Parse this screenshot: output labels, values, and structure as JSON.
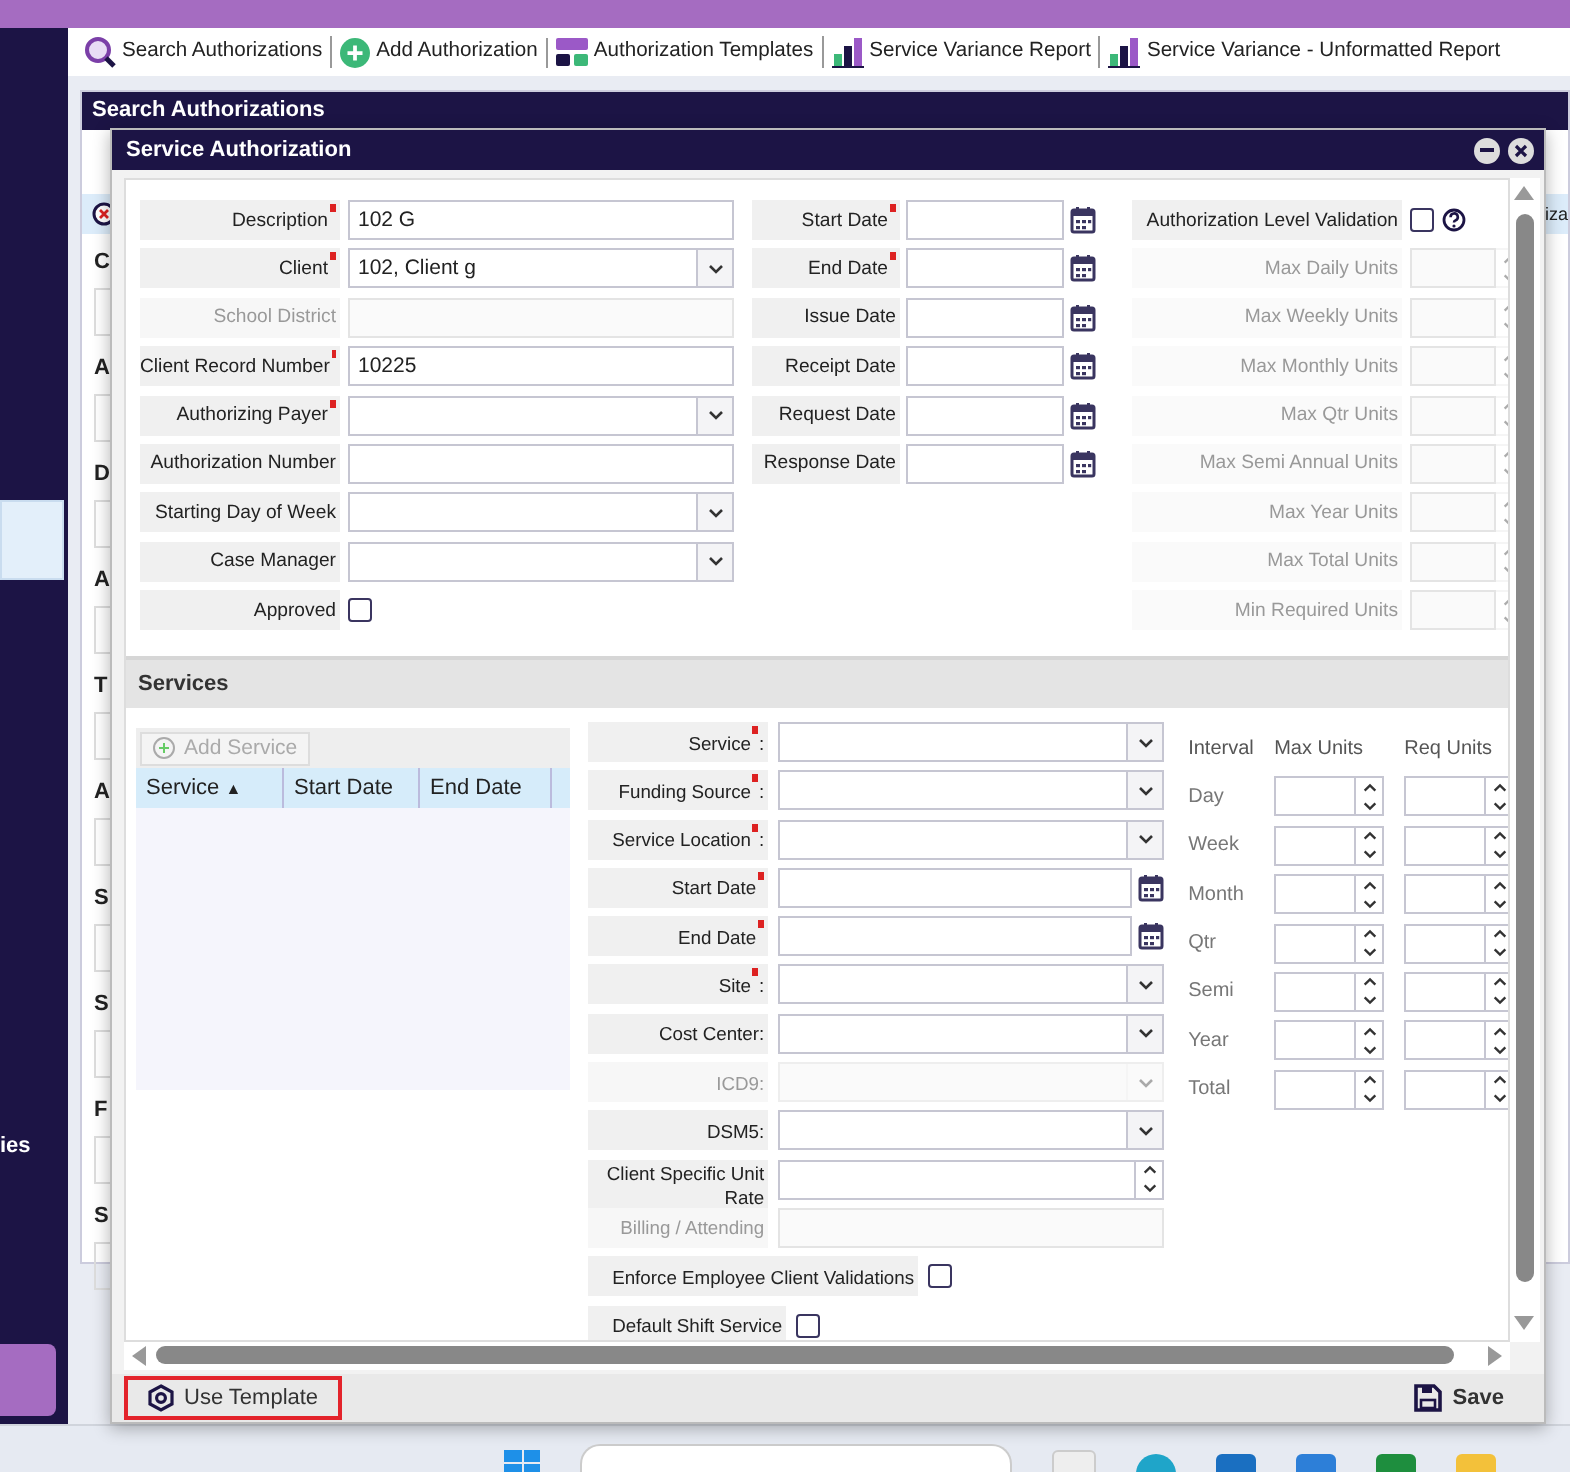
{
  "toolbar": {
    "items": [
      {
        "kind": "search",
        "label": "Search Authorizations"
      },
      {
        "kind": "add",
        "label": "Add Authorization"
      },
      {
        "kind": "templates",
        "label": "Authorization Templates"
      },
      {
        "kind": "report",
        "label": "Service Variance Report"
      },
      {
        "kind": "report",
        "label": "Service Variance - Unformatted Report"
      }
    ]
  },
  "sidebar": {
    "items": [
      {
        "label": "ies"
      }
    ]
  },
  "background_panel": {
    "title": "Search Authorizations",
    "field_initials": [
      "C",
      "A",
      "D",
      "A",
      "T",
      "A",
      "S",
      "S",
      "F",
      "S"
    ],
    "tab_text": "iza"
  },
  "dialog": {
    "title": "Service Authorization",
    "general_fields": [
      {
        "kind": "text",
        "label": "Description",
        "required": true,
        "disabled": false,
        "value": "102 G"
      },
      {
        "kind": "select",
        "label": "Client",
        "required": true,
        "disabled": false,
        "value": "102, Client g"
      },
      {
        "kind": "text",
        "label": "School District",
        "required": false,
        "disabled": true
      },
      {
        "kind": "text",
        "label": "Client Record Number",
        "required": true,
        "disabled": false,
        "value": "10225"
      },
      {
        "kind": "select",
        "label": "Authorizing Payer",
        "required": true,
        "disabled": false
      },
      {
        "kind": "text",
        "label": "Authorization Number",
        "required": false,
        "disabled": false
      },
      {
        "kind": "select",
        "label": "Starting Day of Week",
        "required": false,
        "disabled": false
      },
      {
        "kind": "select",
        "label": "Case Manager",
        "required": false,
        "disabled": false
      },
      {
        "kind": "checkbox",
        "label": "Approved",
        "required": false,
        "disabled": false,
        "checked": false
      }
    ],
    "date_fields": [
      {
        "label": "Start Date",
        "required": true
      },
      {
        "label": "End Date",
        "required": true
      },
      {
        "label": "Issue Date",
        "required": false
      },
      {
        "label": "Receipt Date",
        "required": false
      },
      {
        "label": "Request Date",
        "required": false
      },
      {
        "label": "Response Date",
        "required": false
      }
    ],
    "validation": {
      "label": "Authorization Level Validation",
      "checked": false
    },
    "unit_fields": [
      {
        "label": "Max Daily Units",
        "disabled": true
      },
      {
        "label": "Max Weekly Units",
        "disabled": true
      },
      {
        "label": "Max Monthly Units",
        "disabled": true
      },
      {
        "label": "Max Qtr Units",
        "disabled": true
      },
      {
        "label": "Max Semi Annual Units",
        "disabled": true
      },
      {
        "label": "Max Year Units",
        "disabled": true
      },
      {
        "label": "Max Total Units",
        "disabled": true
      },
      {
        "label": "Min Required Units",
        "disabled": true
      }
    ],
    "services": {
      "title": "Services",
      "add_button": {
        "label": "Add Service",
        "disabled": true
      },
      "grid_columns": [
        {
          "label": "Service",
          "sort_glyph": "▲"
        },
        {
          "label": "Start Date"
        },
        {
          "label": "End Date"
        }
      ],
      "fields": [
        {
          "kind": "select",
          "label": "Service",
          "required": true,
          "suffix": ":",
          "disabled": false
        },
        {
          "kind": "select",
          "label": "Funding Source",
          "required": true,
          "suffix": ":",
          "disabled": false
        },
        {
          "kind": "select",
          "label": "Service Location",
          "required": true,
          "suffix": ":",
          "disabled": false
        },
        {
          "kind": "date",
          "label": "Start Date",
          "required": true,
          "disabled": false
        },
        {
          "kind": "date",
          "label": "End Date",
          "required": true,
          "disabled": false
        },
        {
          "kind": "select",
          "label": "Site",
          "required": true,
          "suffix": ":",
          "disabled": false
        },
        {
          "kind": "select",
          "label": "Cost Center:",
          "required": false,
          "disabled": false
        },
        {
          "kind": "select",
          "label": "ICD9:",
          "required": false,
          "disabled": true
        },
        {
          "kind": "select",
          "label": "DSM5:",
          "required": false,
          "disabled": false
        },
        {
          "kind": "number",
          "label": "Client Specific Unit Rate",
          "required": false,
          "disabled": false
        },
        {
          "kind": "text",
          "label": "Billing / Attending",
          "required": false,
          "disabled": true
        },
        {
          "kind": "checkbox",
          "label": "Enforce Employee Client Validations",
          "required": false,
          "disabled": false,
          "checked": false
        },
        {
          "kind": "checkbox",
          "label": "Default Shift Service",
          "required": false,
          "disabled": false,
          "checked": false
        }
      ],
      "interval_headers": [
        "Interval",
        "Max Units",
        "Req Units"
      ],
      "intervals": [
        {
          "label": "Day"
        },
        {
          "label": "Week"
        },
        {
          "label": "Month"
        },
        {
          "label": "Qtr"
        },
        {
          "label": "Semi"
        },
        {
          "label": "Year"
        },
        {
          "label": "Total"
        }
      ]
    }
  },
  "footer": {
    "use_template": {
      "label": "Use Template",
      "highlighted": true
    },
    "save": {
      "label": "Save"
    }
  }
}
